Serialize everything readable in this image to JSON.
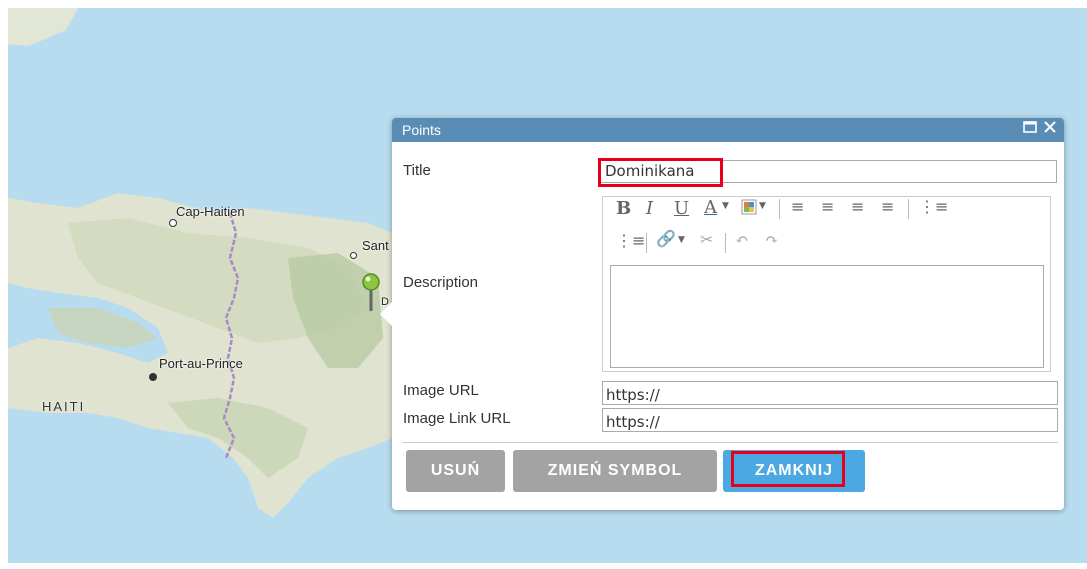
{
  "map": {
    "cities": [
      "Cap-Haitien",
      "Sant",
      "Port-au-Prince"
    ],
    "country": "HAITI",
    "marker_letter": "D",
    "colors": {
      "water": "#b8dcef",
      "land": "#dfe3cf",
      "border": "#a78cc4"
    }
  },
  "popup": {
    "title": "Points",
    "maximize_icon": "maximize-icon",
    "close_icon": "close-icon",
    "title_label": "Title",
    "title_value": "Dominikana",
    "description_label": "Description",
    "image_url_label": "Image URL",
    "image_url_value": "https://",
    "image_link_label": "Image Link URL",
    "image_link_value": "https://",
    "toolbar_icons": [
      "bold-icon",
      "italic-icon",
      "underline-icon",
      "font-color-icon",
      "highlight-color-icon",
      "align-left-icon",
      "align-center-icon",
      "align-right-icon",
      "justify-icon",
      "numbered-list-icon",
      "bullet-list-icon",
      "link-icon",
      "unlink-icon",
      "undo-icon",
      "redo-icon"
    ],
    "buttons": {
      "delete": "USUŃ",
      "change_symbol": "ZMIEŃ SYMBOL",
      "close": "ZAMKNIJ"
    },
    "colors": {
      "titlebar": "#5a8db6",
      "gray_button": "#a3a3a3",
      "blue_button": "#4ba8e2",
      "highlight": "#e8001a"
    }
  }
}
